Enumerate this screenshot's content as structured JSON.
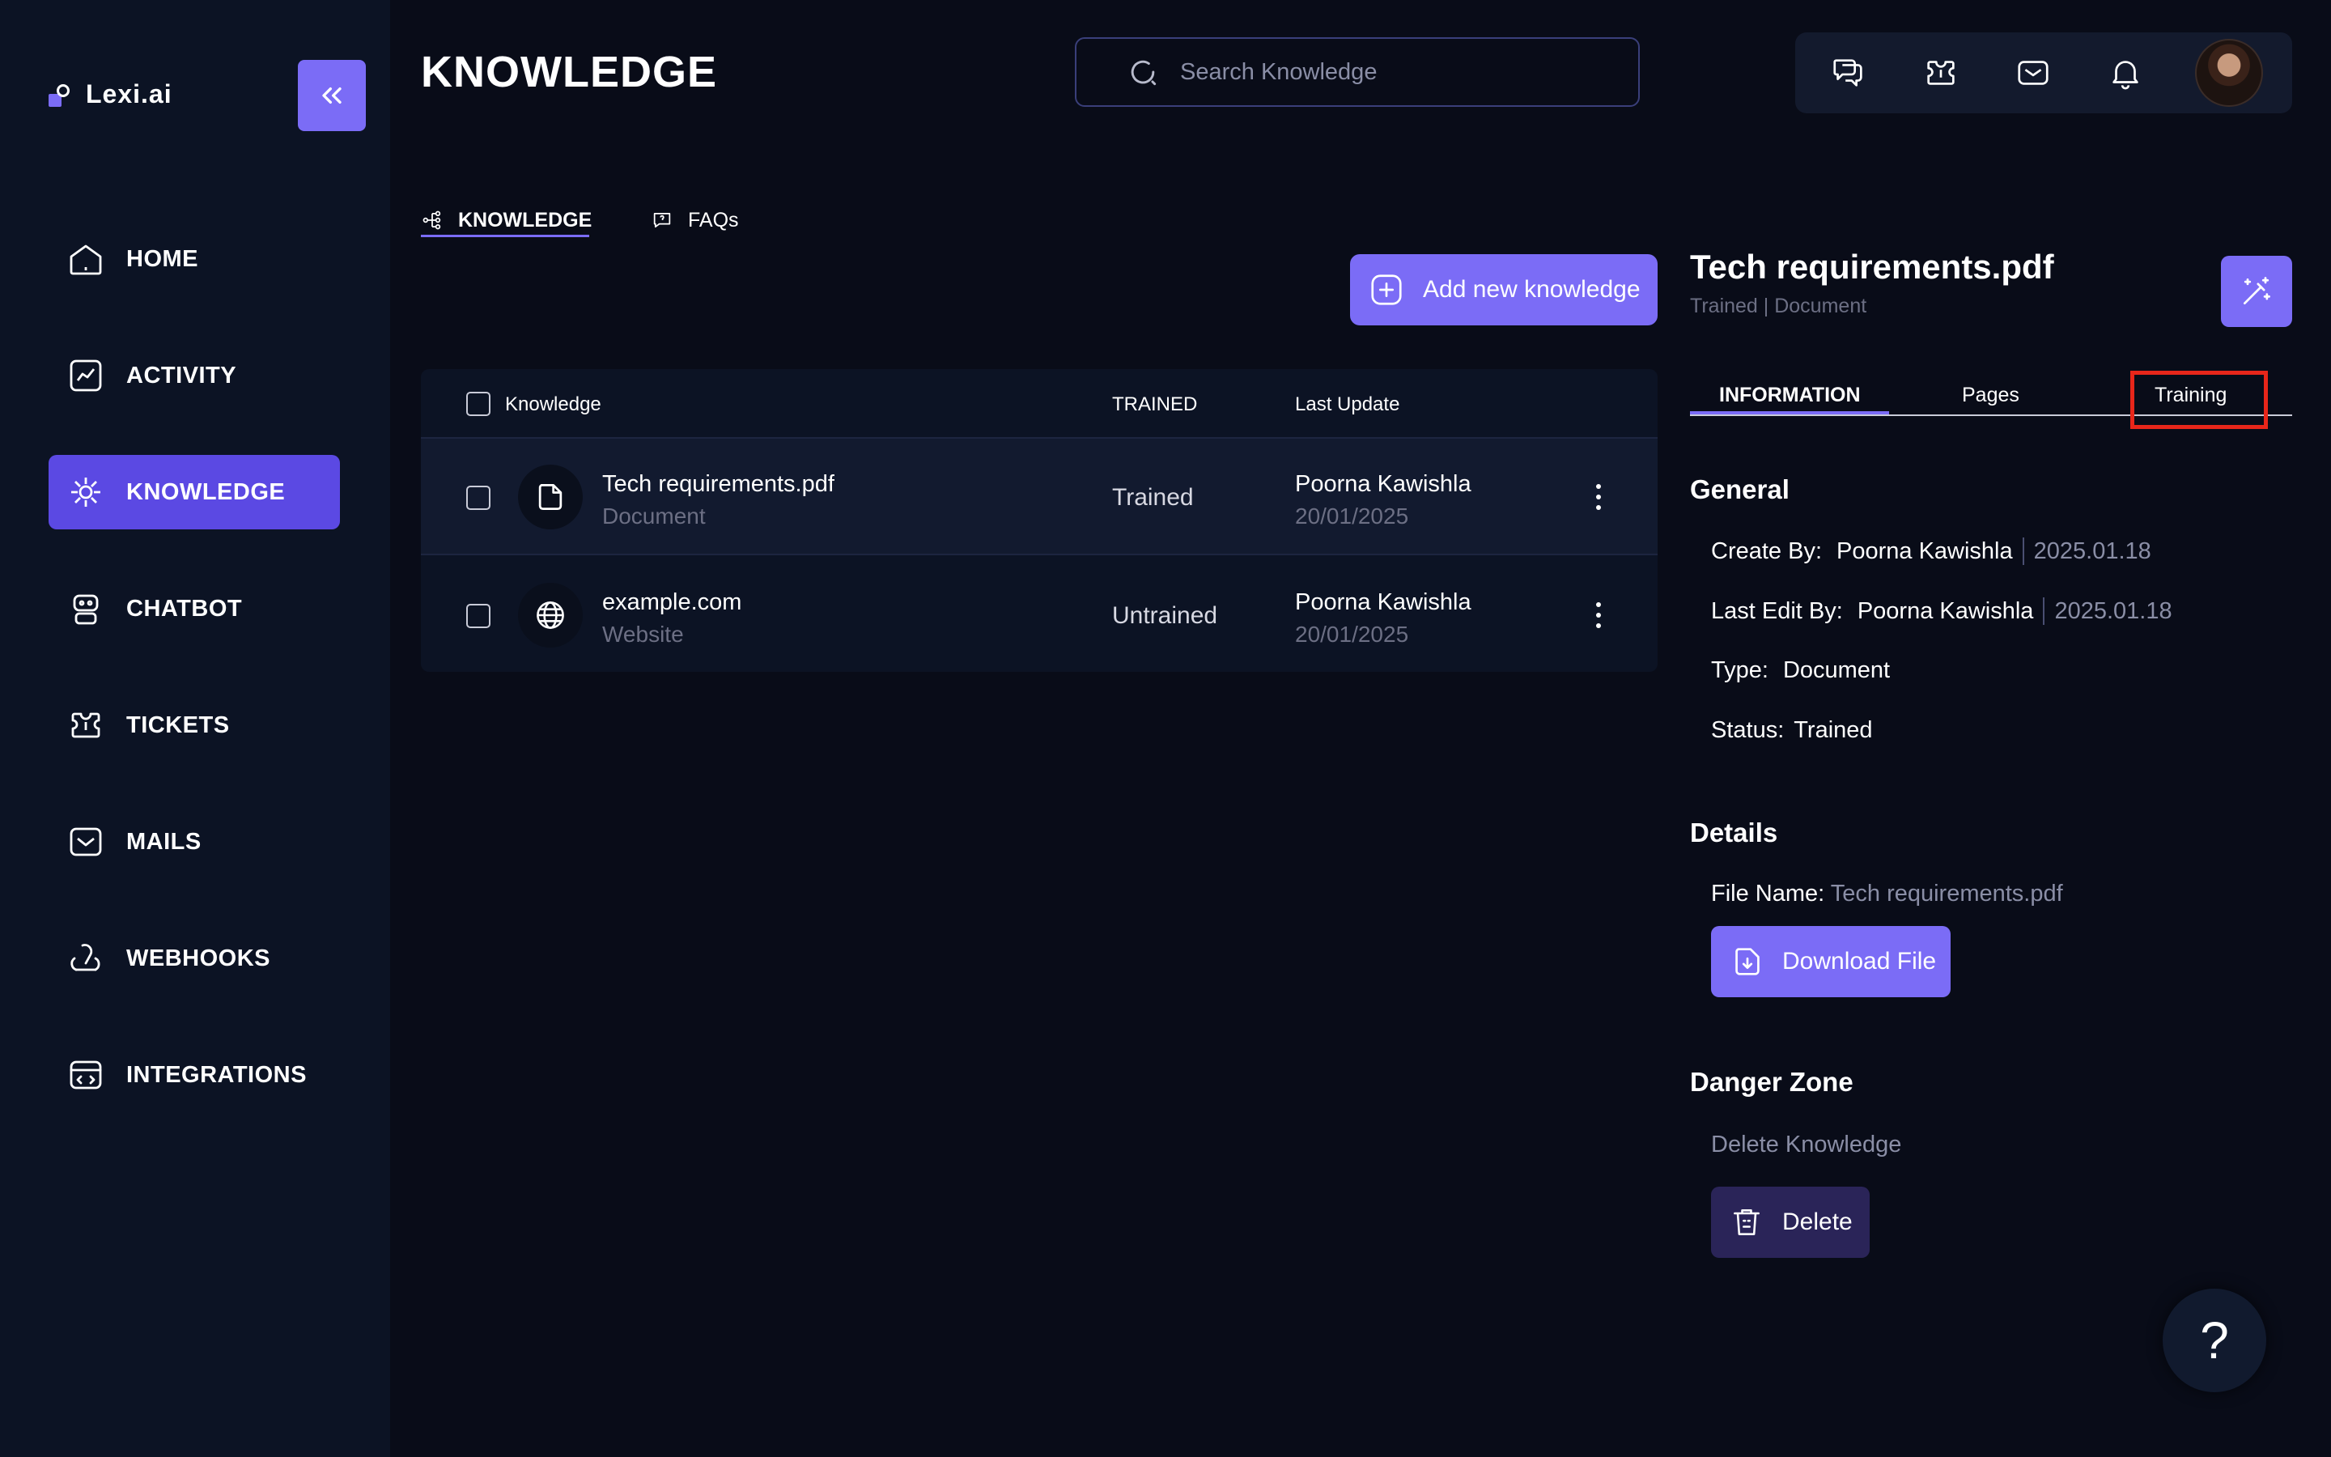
{
  "brand": {
    "name": "Lexi.ai"
  },
  "nav": {
    "items": [
      {
        "label": "HOME",
        "icon": "home-icon"
      },
      {
        "label": "ACTIVITY",
        "icon": "activity-icon"
      },
      {
        "label": "KNOWLEDGE",
        "icon": "knowledge-icon",
        "active": true
      },
      {
        "label": "CHATBOT",
        "icon": "robot-icon"
      },
      {
        "label": "TICKETS",
        "icon": "ticket-icon"
      },
      {
        "label": "MAILS",
        "icon": "mail-icon"
      },
      {
        "label": "WEBHOOKS",
        "icon": "webhook-icon"
      },
      {
        "label": "INTEGRATIONS",
        "icon": "integrations-icon"
      }
    ]
  },
  "header": {
    "title": "KNOWLEDGE",
    "search_placeholder": "Search Knowledge",
    "tools": [
      "chat-icon",
      "puzzle-icon",
      "mail-icon",
      "bell-icon",
      "avatar"
    ]
  },
  "subtabs": [
    {
      "label": "KNOWLEDGE",
      "active": true
    },
    {
      "label": "FAQs",
      "active": false
    }
  ],
  "add_button": {
    "label": "Add new knowledge"
  },
  "table": {
    "headers": {
      "name": "Knowledge",
      "trained": "TRAINED",
      "updated": "Last Update"
    },
    "rows": [
      {
        "title": "Tech requirements.pdf",
        "type": "Document",
        "status": "Trained",
        "user": "Poorna Kawishla",
        "date": "20/01/2025"
      },
      {
        "title": "example.com",
        "type": "Website",
        "status": "Untrained",
        "user": "Poorna Kawishla",
        "date": "20/01/2025"
      }
    ]
  },
  "detail": {
    "title": "Tech requirements.pdf",
    "subtitle": "Trained | Document",
    "tabs": [
      "INFORMATION",
      "Pages",
      "Training"
    ],
    "general": {
      "heading": "General",
      "create_by_label": "Create By:",
      "create_by_value": "Poorna Kawishla",
      "create_by_date": "2025.01.18",
      "last_edit_label": "Last Edit By:",
      "last_edit_value": "Poorna Kawishla",
      "last_edit_date": "2025.01.18",
      "type_label": "Type:",
      "type_value": "Document",
      "status_label": "Status:",
      "status_value": "Trained"
    },
    "details": {
      "heading": "Details",
      "file_name_label": "File Name:",
      "file_name_value": "Tech requirements.pdf",
      "download_label": "Download File"
    },
    "danger": {
      "heading": "Danger Zone",
      "text": "Delete Knowledge",
      "delete_label": "Delete"
    }
  },
  "help": {
    "label": "?"
  },
  "colors": {
    "accent": "#7b6cf6",
    "active_nav": "#5b49e3",
    "background": "#090c18",
    "sidebar": "#0c1324",
    "highlight": "#e8261a"
  }
}
